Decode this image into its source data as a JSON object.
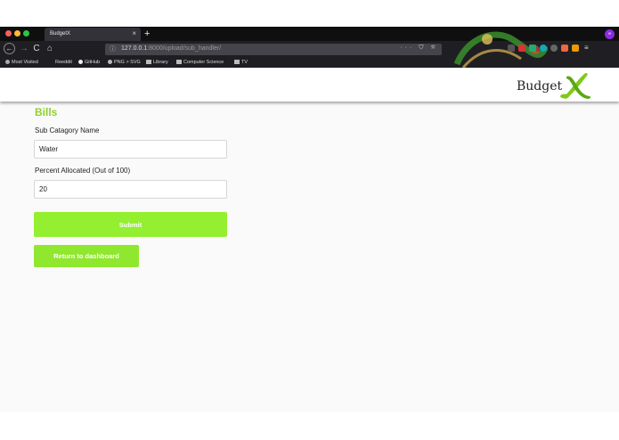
{
  "browser": {
    "tab_title": "BudgetX",
    "tab_close": "×",
    "new_tab": "+",
    "profile_label": "∞",
    "nav": {
      "back": "←",
      "forward": "→",
      "reload": "C",
      "home": "⌂"
    },
    "url_info_icon": "ⓘ",
    "url_host": "127.0.0.1",
    "url_port": ":8000",
    "url_path": "/upload/sub_handler/",
    "url_actions": "··· ⛉ ☆",
    "bookmarks": [
      {
        "label": "Most Visited",
        "icon": "gear-icon"
      },
      {
        "label": "Reeddit",
        "icon": "reddit-icon"
      },
      {
        "label": "GitHub",
        "icon": "github-icon"
      },
      {
        "label": "PNG > SVG",
        "icon": "globe-icon"
      },
      {
        "label": "Library",
        "icon": "folder-icon"
      },
      {
        "label": "Computer Science",
        "icon": "folder-icon"
      },
      {
        "label": "TV",
        "icon": "folder-icon"
      }
    ]
  },
  "colors": {
    "accent": "#93ef2f",
    "title": "#8fd12c",
    "chrome": "#1f1f23"
  },
  "app": {
    "brand": "Budget"
  },
  "form": {
    "title": "Bills",
    "sub_category_label": "Sub Catagory Name",
    "sub_category_value": "Water",
    "percent_label": "Percent Allocated (Out of 100)",
    "percent_value": "20",
    "submit_label": "Submit",
    "return_label": "Return to dashboard"
  }
}
